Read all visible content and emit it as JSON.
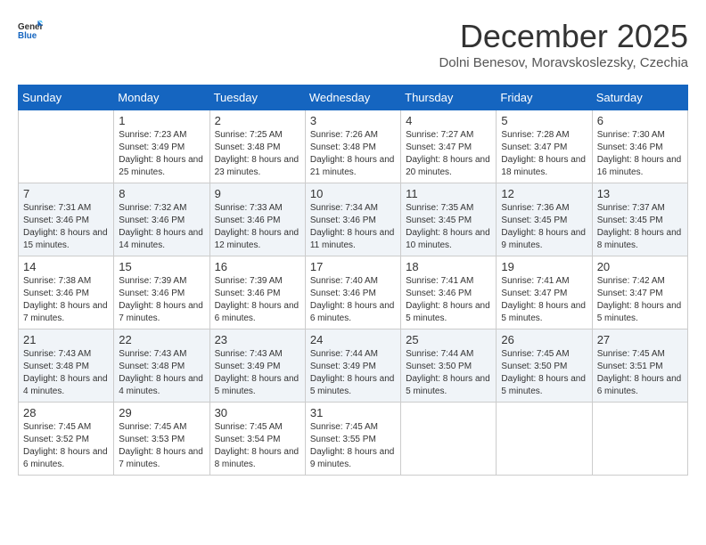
{
  "header": {
    "logo_line1": "General",
    "logo_line2": "Blue",
    "month_title": "December 2025",
    "subtitle": "Dolni Benesov, Moravskoslezsky, Czechia"
  },
  "days_of_week": [
    "Sunday",
    "Monday",
    "Tuesday",
    "Wednesday",
    "Thursday",
    "Friday",
    "Saturday"
  ],
  "weeks": [
    [
      {
        "day": "",
        "sunrise": "",
        "sunset": "",
        "daylight": ""
      },
      {
        "day": "1",
        "sunrise": "Sunrise: 7:23 AM",
        "sunset": "Sunset: 3:49 PM",
        "daylight": "Daylight: 8 hours and 25 minutes."
      },
      {
        "day": "2",
        "sunrise": "Sunrise: 7:25 AM",
        "sunset": "Sunset: 3:48 PM",
        "daylight": "Daylight: 8 hours and 23 minutes."
      },
      {
        "day": "3",
        "sunrise": "Sunrise: 7:26 AM",
        "sunset": "Sunset: 3:48 PM",
        "daylight": "Daylight: 8 hours and 21 minutes."
      },
      {
        "day": "4",
        "sunrise": "Sunrise: 7:27 AM",
        "sunset": "Sunset: 3:47 PM",
        "daylight": "Daylight: 8 hours and 20 minutes."
      },
      {
        "day": "5",
        "sunrise": "Sunrise: 7:28 AM",
        "sunset": "Sunset: 3:47 PM",
        "daylight": "Daylight: 8 hours and 18 minutes."
      },
      {
        "day": "6",
        "sunrise": "Sunrise: 7:30 AM",
        "sunset": "Sunset: 3:46 PM",
        "daylight": "Daylight: 8 hours and 16 minutes."
      }
    ],
    [
      {
        "day": "7",
        "sunrise": "Sunrise: 7:31 AM",
        "sunset": "Sunset: 3:46 PM",
        "daylight": "Daylight: 8 hours and 15 minutes."
      },
      {
        "day": "8",
        "sunrise": "Sunrise: 7:32 AM",
        "sunset": "Sunset: 3:46 PM",
        "daylight": "Daylight: 8 hours and 14 minutes."
      },
      {
        "day": "9",
        "sunrise": "Sunrise: 7:33 AM",
        "sunset": "Sunset: 3:46 PM",
        "daylight": "Daylight: 8 hours and 12 minutes."
      },
      {
        "day": "10",
        "sunrise": "Sunrise: 7:34 AM",
        "sunset": "Sunset: 3:46 PM",
        "daylight": "Daylight: 8 hours and 11 minutes."
      },
      {
        "day": "11",
        "sunrise": "Sunrise: 7:35 AM",
        "sunset": "Sunset: 3:45 PM",
        "daylight": "Daylight: 8 hours and 10 minutes."
      },
      {
        "day": "12",
        "sunrise": "Sunrise: 7:36 AM",
        "sunset": "Sunset: 3:45 PM",
        "daylight": "Daylight: 8 hours and 9 minutes."
      },
      {
        "day": "13",
        "sunrise": "Sunrise: 7:37 AM",
        "sunset": "Sunset: 3:45 PM",
        "daylight": "Daylight: 8 hours and 8 minutes."
      }
    ],
    [
      {
        "day": "14",
        "sunrise": "Sunrise: 7:38 AM",
        "sunset": "Sunset: 3:46 PM",
        "daylight": "Daylight: 8 hours and 7 minutes."
      },
      {
        "day": "15",
        "sunrise": "Sunrise: 7:39 AM",
        "sunset": "Sunset: 3:46 PM",
        "daylight": "Daylight: 8 hours and 7 minutes."
      },
      {
        "day": "16",
        "sunrise": "Sunrise: 7:39 AM",
        "sunset": "Sunset: 3:46 PM",
        "daylight": "Daylight: 8 hours and 6 minutes."
      },
      {
        "day": "17",
        "sunrise": "Sunrise: 7:40 AM",
        "sunset": "Sunset: 3:46 PM",
        "daylight": "Daylight: 8 hours and 6 minutes."
      },
      {
        "day": "18",
        "sunrise": "Sunrise: 7:41 AM",
        "sunset": "Sunset: 3:46 PM",
        "daylight": "Daylight: 8 hours and 5 minutes."
      },
      {
        "day": "19",
        "sunrise": "Sunrise: 7:41 AM",
        "sunset": "Sunset: 3:47 PM",
        "daylight": "Daylight: 8 hours and 5 minutes."
      },
      {
        "day": "20",
        "sunrise": "Sunrise: 7:42 AM",
        "sunset": "Sunset: 3:47 PM",
        "daylight": "Daylight: 8 hours and 5 minutes."
      }
    ],
    [
      {
        "day": "21",
        "sunrise": "Sunrise: 7:43 AM",
        "sunset": "Sunset: 3:48 PM",
        "daylight": "Daylight: 8 hours and 4 minutes."
      },
      {
        "day": "22",
        "sunrise": "Sunrise: 7:43 AM",
        "sunset": "Sunset: 3:48 PM",
        "daylight": "Daylight: 8 hours and 4 minutes."
      },
      {
        "day": "23",
        "sunrise": "Sunrise: 7:43 AM",
        "sunset": "Sunset: 3:49 PM",
        "daylight": "Daylight: 8 hours and 5 minutes."
      },
      {
        "day": "24",
        "sunrise": "Sunrise: 7:44 AM",
        "sunset": "Sunset: 3:49 PM",
        "daylight": "Daylight: 8 hours and 5 minutes."
      },
      {
        "day": "25",
        "sunrise": "Sunrise: 7:44 AM",
        "sunset": "Sunset: 3:50 PM",
        "daylight": "Daylight: 8 hours and 5 minutes."
      },
      {
        "day": "26",
        "sunrise": "Sunrise: 7:45 AM",
        "sunset": "Sunset: 3:50 PM",
        "daylight": "Daylight: 8 hours and 5 minutes."
      },
      {
        "day": "27",
        "sunrise": "Sunrise: 7:45 AM",
        "sunset": "Sunset: 3:51 PM",
        "daylight": "Daylight: 8 hours and 6 minutes."
      }
    ],
    [
      {
        "day": "28",
        "sunrise": "Sunrise: 7:45 AM",
        "sunset": "Sunset: 3:52 PM",
        "daylight": "Daylight: 8 hours and 6 minutes."
      },
      {
        "day": "29",
        "sunrise": "Sunrise: 7:45 AM",
        "sunset": "Sunset: 3:53 PM",
        "daylight": "Daylight: 8 hours and 7 minutes."
      },
      {
        "day": "30",
        "sunrise": "Sunrise: 7:45 AM",
        "sunset": "Sunset: 3:54 PM",
        "daylight": "Daylight: 8 hours and 8 minutes."
      },
      {
        "day": "31",
        "sunrise": "Sunrise: 7:45 AM",
        "sunset": "Sunset: 3:55 PM",
        "daylight": "Daylight: 8 hours and 9 minutes."
      },
      {
        "day": "",
        "sunrise": "",
        "sunset": "",
        "daylight": ""
      },
      {
        "day": "",
        "sunrise": "",
        "sunset": "",
        "daylight": ""
      },
      {
        "day": "",
        "sunrise": "",
        "sunset": "",
        "daylight": ""
      }
    ]
  ]
}
